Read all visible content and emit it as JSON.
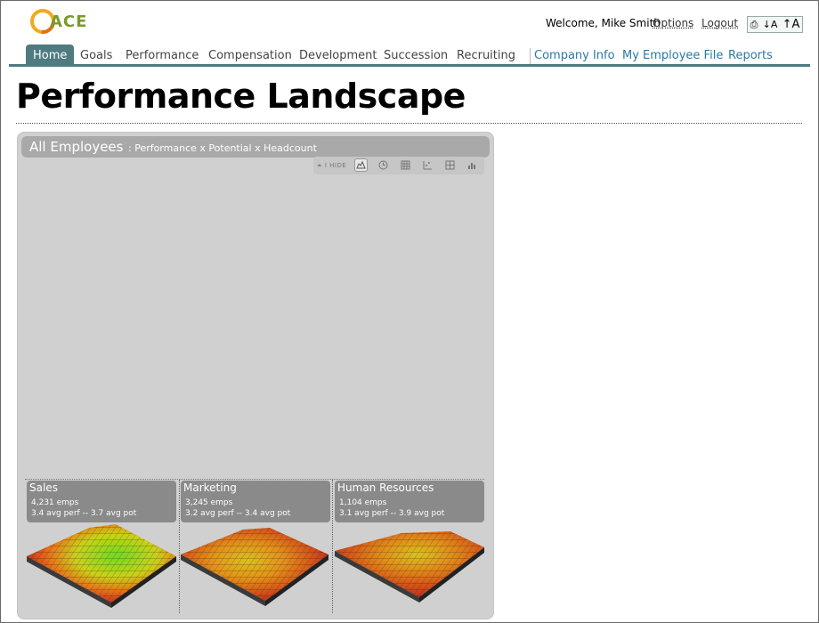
{
  "header": {
    "logo_text": "ACE",
    "welcome": "Welcome, Mike Smith",
    "options": "Options",
    "logout": "Logout",
    "tools": {
      "print_icon": "printer-icon",
      "text_smaller": "↓A",
      "text_larger": "↑A"
    }
  },
  "nav": {
    "tabs": [
      {
        "label": "Home"
      },
      {
        "label": "Goals"
      },
      {
        "label": "Performance"
      },
      {
        "label": "Compensation"
      },
      {
        "label": "Development"
      },
      {
        "label": "Succession"
      },
      {
        "label": "Recruiting"
      },
      {
        "label": "Company Info"
      },
      {
        "label": "My Employee File"
      },
      {
        "label": "Reports"
      }
    ],
    "active": "Home"
  },
  "page": {
    "title": "Performance Landscape"
  },
  "panel": {
    "title": "All Employees",
    "subtitle": ": Performance x Potential x Headcount",
    "hide_label": "⏶ I HIDE",
    "view_icons": [
      "landscape-icon",
      "clock-icon",
      "grid-icon",
      "scatter-icon",
      "crosshair-icon",
      "bar-chart-icon"
    ]
  },
  "departments": [
    {
      "name": "Sales",
      "emps": "4,231 emps",
      "stats": "3.4 avg perf -- 3.7 avg pot"
    },
    {
      "name": "Marketing",
      "emps": "3,245 emps",
      "stats": "3.2 avg perf -- 3.4 avg pot"
    },
    {
      "name": "Human Resources",
      "emps": "1,104 emps",
      "stats": "3.1 avg perf -- 3.9 avg pot"
    }
  ],
  "colors": {
    "nav_active": "#4e7a80",
    "link_blue": "#2a78a8",
    "panel_bg": "#d0d0d0"
  }
}
